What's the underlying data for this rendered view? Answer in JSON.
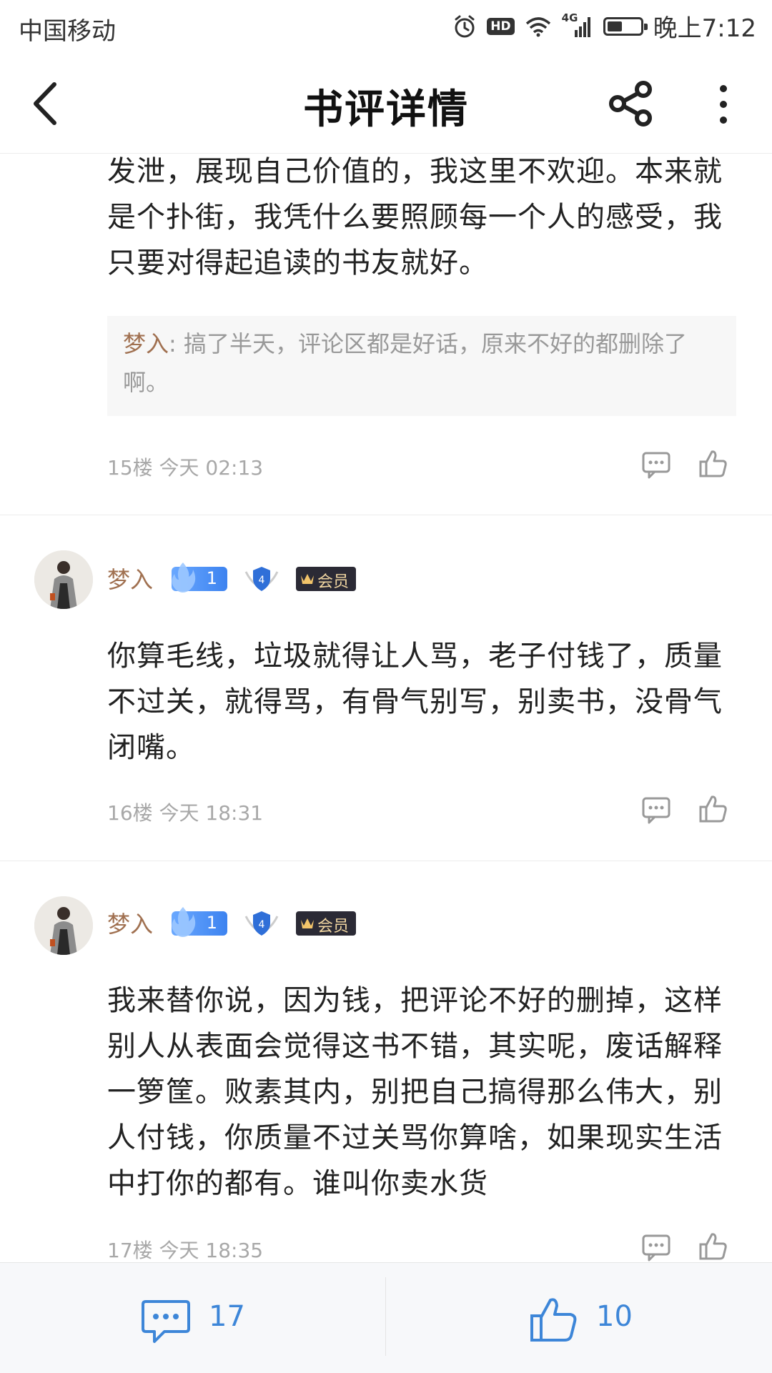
{
  "status_bar": {
    "carrier": "中国移动",
    "time": "晚上7:12",
    "hd": "HD",
    "network": "4G",
    "battery_level": 0.45
  },
  "header": {
    "title": "书评详情"
  },
  "comments": [
    {
      "body": "发泄，展现自己价值的，我这里不欢迎。本来就是个扑街，我凭什么要照顾每一个人的感受，我只要对得起追读的书友就好。",
      "quote": {
        "name": "梦入",
        "sep": ": ",
        "text": "搞了半天，评论区都是好话，原来不好的都删除了啊。"
      },
      "meta": "15楼 今天 02:13"
    },
    {
      "user": "梦入",
      "fire_level": "1",
      "shield_level": "4",
      "vip": "会员",
      "body": "你算毛线，垃圾就得让人骂，老子付钱了，质量不过关，就得骂，有骨气别写，别卖书，没骨气闭嘴。",
      "meta": "16楼 今天 18:31"
    },
    {
      "user": "梦入",
      "fire_level": "1",
      "shield_level": "4",
      "vip": "会员",
      "body": "我来替你说，因为钱，把评论不好的删掉，这样别人从表面会觉得这书不错，其实呢，废话解释一箩筐。败素其内，别把自己搞得那么伟大，别人付钱，你质量不过关骂你算啥，如果现实生活中打你的都有。谁叫你卖水货",
      "meta": "17楼 今天 18:35"
    }
  ],
  "bottom_bar": {
    "comment_count": "17",
    "like_count": "10"
  },
  "colors": {
    "accent_blue": "#3d86d8",
    "username_brown": "#a07050",
    "meta_gray": "#a8a8a8"
  }
}
